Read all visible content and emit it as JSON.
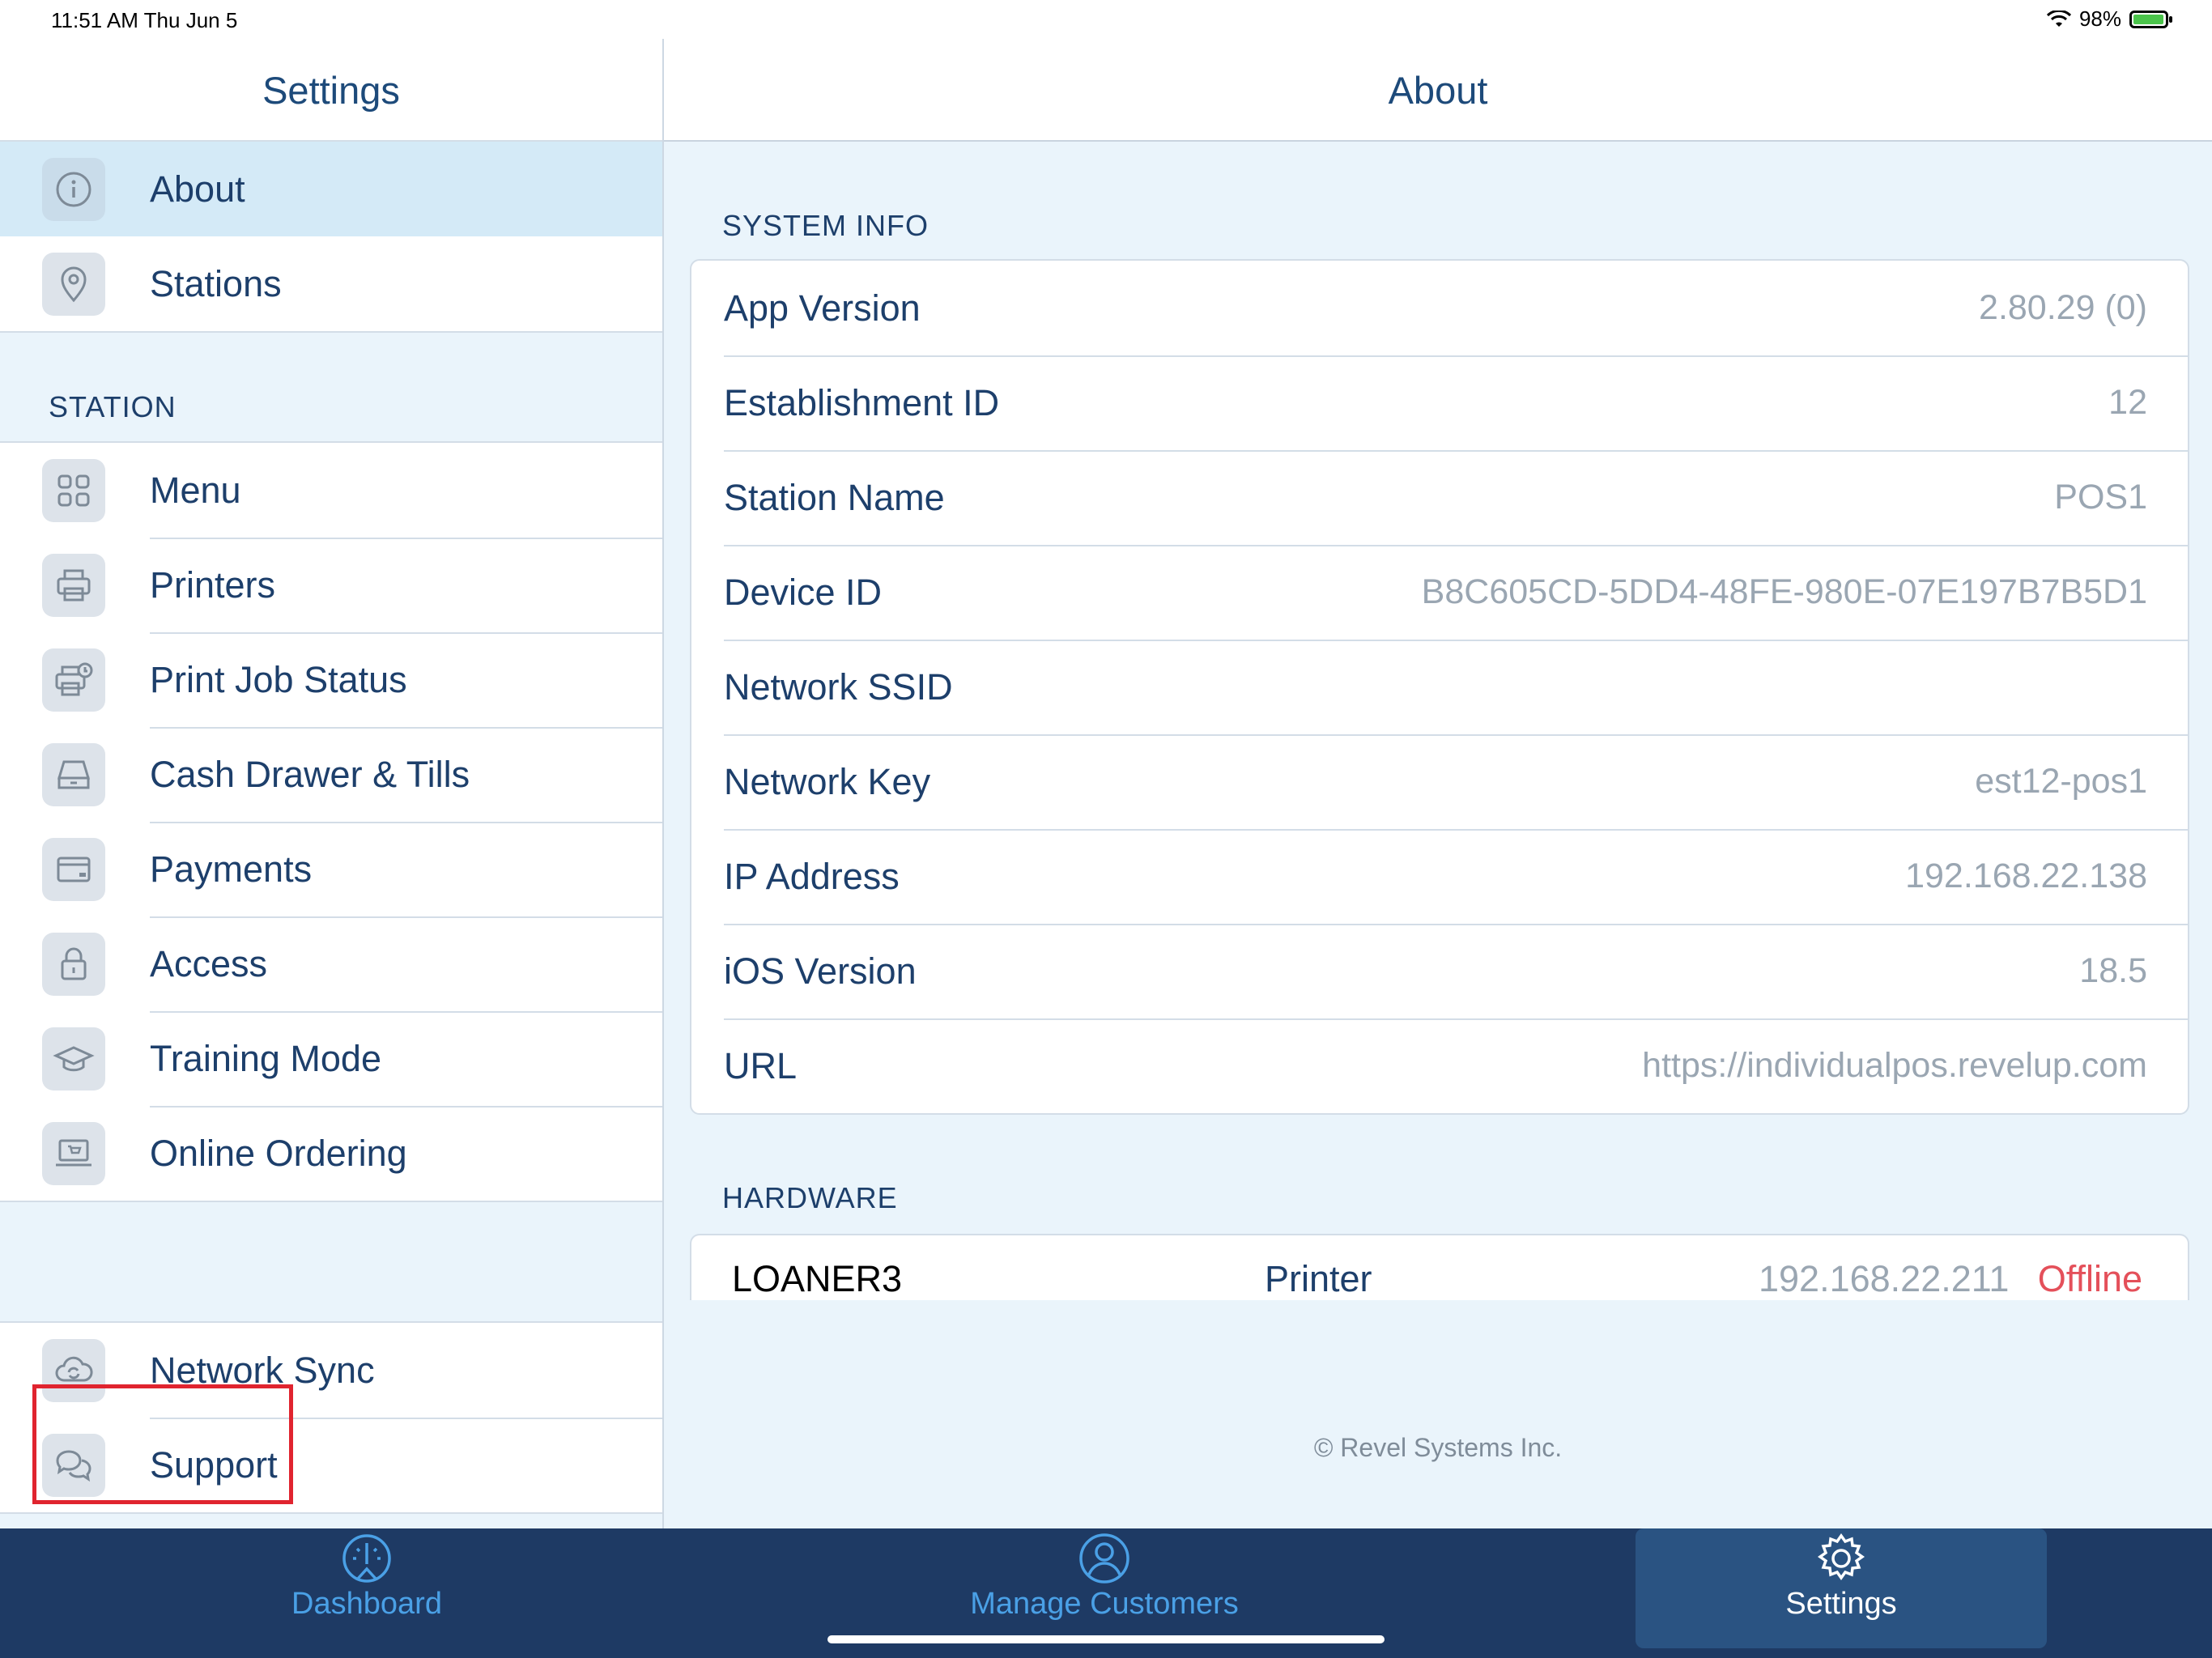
{
  "status_bar": {
    "time": "11:51 AM   Thu Jun 5",
    "battery": "98%",
    "battery_level": 0.98
  },
  "sidebar": {
    "title": "Settings",
    "top_items": [
      {
        "label": "About",
        "icon": "info-icon",
        "selected": true
      },
      {
        "label": "Stations",
        "icon": "location-pin-icon"
      }
    ],
    "station_section_label": "STATION",
    "station_items": [
      {
        "label": "Menu",
        "icon": "grid-icon"
      },
      {
        "label": "Printers",
        "icon": "printer-icon"
      },
      {
        "label": "Print Job Status",
        "icon": "printer-clock-icon"
      },
      {
        "label": "Cash Drawer & Tills",
        "icon": "cash-drawer-icon"
      },
      {
        "label": "Payments",
        "icon": "card-icon"
      },
      {
        "label": "Access",
        "icon": "lock-icon"
      },
      {
        "label": "Training Mode",
        "icon": "graduation-cap-icon"
      },
      {
        "label": "Online Ordering",
        "icon": "online-cart-icon"
      }
    ],
    "bottom_items": [
      {
        "label": "Network Sync",
        "icon": "cloud-sync-icon"
      },
      {
        "label": "Support",
        "icon": "chat-bubbles-icon",
        "highlighted": true
      }
    ]
  },
  "main": {
    "title": "About",
    "system_info_label": "SYSTEM INFO",
    "system_info": [
      {
        "key": "App Version",
        "value": "2.80.29 (0)"
      },
      {
        "key": "Establishment ID",
        "value": "12"
      },
      {
        "key": "Station Name",
        "value": "POS1"
      },
      {
        "key": "Device ID",
        "value": "B8C605CD-5DD4-48FE-980E-07E197B7B5D1"
      },
      {
        "key": "Network SSID",
        "value": ""
      },
      {
        "key": "Network Key",
        "value": "est12-pos1"
      },
      {
        "key": "IP Address",
        "value": "192.168.22.138"
      },
      {
        "key": "iOS Version",
        "value": "18.5"
      },
      {
        "key": "URL",
        "value": "https://individualpos.revelup.com"
      }
    ],
    "hardware_label": "HARDWARE",
    "hardware": [
      {
        "name": "LOANER3",
        "type": "Printer",
        "ip": "192.168.22.211",
        "status": "Offline"
      }
    ],
    "copyright": "© Revel Systems Inc."
  },
  "tab_bar": {
    "tabs": [
      {
        "label": "Dashboard",
        "icon": "dashboard-gauge-icon",
        "active": false
      },
      {
        "label": "Manage Customers",
        "icon": "person-icon",
        "active": false
      },
      {
        "label": "Settings",
        "icon": "gear-icon",
        "active": true
      }
    ]
  },
  "colors": {
    "accent": "#1e3a64",
    "selected_row": "#d4eaf7",
    "offline": "#e4505a",
    "highlight_box": "#e0242f"
  }
}
